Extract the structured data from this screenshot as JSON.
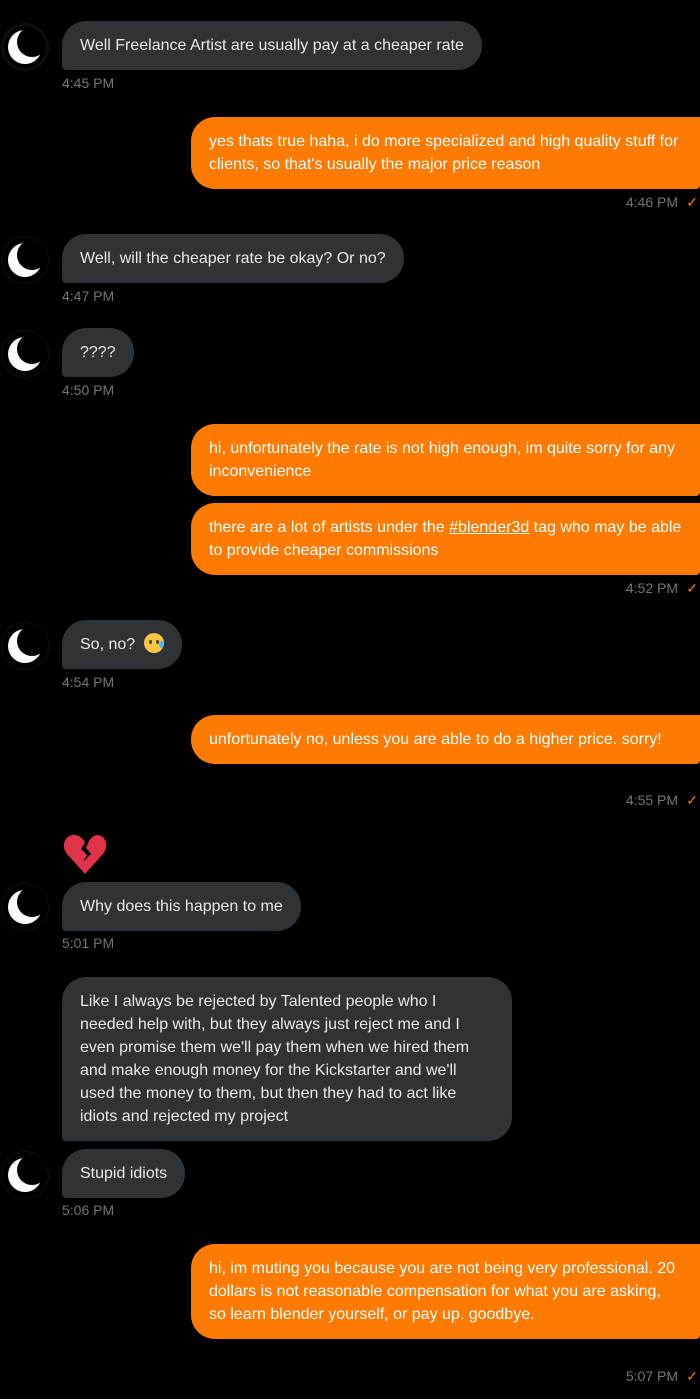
{
  "messages": [
    {
      "text": "Well Freelance Artist are usually pay at a cheaper rate",
      "time": "4:45 PM"
    },
    {
      "text": "yes thats true haha, i do more specialized and high quality stuff for clients, so that's usually the major price reason",
      "time": "4:46 PM"
    },
    {
      "text": "Well, will the cheaper rate be okay? Or no?",
      "time": "4:47 PM"
    },
    {
      "text": "????",
      "time": "4:50 PM"
    },
    {
      "text": "hi, unfortunately the rate is not high enough, im quite sorry for any inconvenience"
    },
    {
      "text_before": "there are a lot of artists under the ",
      "hashtag": "#blender3d",
      "text_after": " tag who may be able to provide cheaper commissions",
      "time": "4:52 PM"
    },
    {
      "text": "So, no?",
      "emoji": "crying-face",
      "time": "4:54 PM"
    },
    {
      "text": "unfortunately no, unless you are able to do a higher price. sorry!",
      "time": "4:55 PM"
    },
    {
      "reaction": "broken-heart-emoji"
    },
    {
      "text": "Why does this happen to me",
      "time": "5:01 PM"
    },
    {
      "text": "Like I always be rejected by Talented people who I needed help with, but they always just reject me and I even promise them we'll pay them when we hired them and make enough money for the Kickstarter and we'll used the money to them, but then they had to act like idiots and rejected my project"
    },
    {
      "text": "Stupid idiots",
      "time": "5:06 PM"
    },
    {
      "text": "hi, im muting you because you are not being very professional. 20 dollars is not reasonable compensation for what you are asking, so learn blender yourself, or pay up. goodbye.",
      "time": "5:07 PM"
    }
  ],
  "colors": {
    "background": "#000000",
    "incoming_bubble": "#2f3336",
    "outgoing_bubble": "#ff7a00",
    "timestamp": "#71767b"
  },
  "icons": {
    "avatar": "crescent-moon-avatar",
    "read_receipt": "check-icon"
  }
}
